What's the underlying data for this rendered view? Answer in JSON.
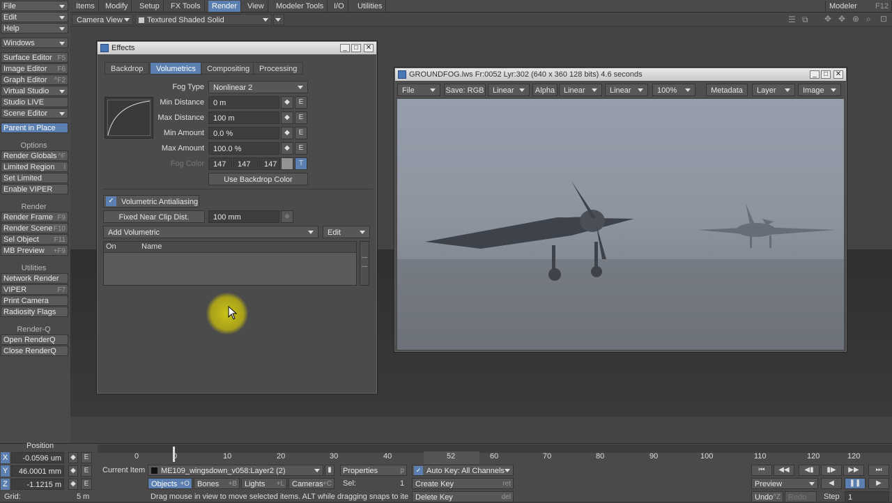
{
  "top_menu": {
    "items": [
      "Items",
      "Modify",
      "Setup",
      "FX Tools",
      "Render",
      "View",
      "Modeler Tools",
      "I/O",
      "Utilities"
    ],
    "active": "Render",
    "modeler": {
      "label": "Modeler",
      "shortcut": "F12"
    }
  },
  "left_panel": {
    "file": "File",
    "edit": "Edit",
    "help": "Help",
    "windows": "Windows",
    "editors": [
      {
        "label": "Surface Editor",
        "shortcut": "F5"
      },
      {
        "label": "Image Editor",
        "shortcut": "F6"
      },
      {
        "label": "Graph Editor",
        "shortcut": "^F2"
      },
      {
        "label": "Virtual Studio",
        "shortcut": ""
      },
      {
        "label": "Studio LIVE",
        "shortcut": ""
      },
      {
        "label": "Scene Editor",
        "shortcut": ""
      }
    ],
    "parent_in_place": "Parent in Place",
    "options_header": "Options",
    "options": [
      {
        "label": "Render Globals",
        "shortcut": "^F"
      },
      {
        "label": "Limited Region",
        "shortcut": "l"
      },
      {
        "label": "Set Limited Region",
        "shortcut": ""
      },
      {
        "label": "Enable VIPER",
        "shortcut": ""
      }
    ],
    "render_header": "Render",
    "render": [
      {
        "label": "Render Frame",
        "shortcut": "F9"
      },
      {
        "label": "Render Scene",
        "shortcut": "F10"
      },
      {
        "label": "Sel Object",
        "shortcut": "F11"
      },
      {
        "label": "MB Preview",
        "shortcut": "+F9"
      }
    ],
    "utilities_header": "Utilities",
    "utilities": [
      {
        "label": "Network Render",
        "shortcut": ""
      },
      {
        "label": "VIPER",
        "shortcut": "F7"
      },
      {
        "label": "Print Camera",
        "shortcut": ""
      },
      {
        "label": "Radiosity Flags",
        "shortcut": ""
      }
    ],
    "renderq_header": "Render-Q",
    "renderq": [
      {
        "label": "Open RenderQ",
        "shortcut": ""
      },
      {
        "label": "Close RenderQ",
        "shortcut": ""
      }
    ]
  },
  "viewport": {
    "camera": "Camera View",
    "shading": "Textured Shaded Solid"
  },
  "effects": {
    "title": "Effects",
    "tabs": [
      "Backdrop",
      "Volumetrics",
      "Compositing",
      "Processing"
    ],
    "active_tab": "Volumetrics",
    "fog_type_label": "Fog Type",
    "fog_type": "Nonlinear 2",
    "min_distance_label": "Min Distance",
    "min_distance": "0 m",
    "max_distance_label": "Max Distance",
    "max_distance": "100 m",
    "min_amount_label": "Min Amount",
    "min_amount": "0.0 %",
    "max_amount_label": "Max Amount",
    "max_amount": "100.0 %",
    "fog_color_label": "Fog Color",
    "fog_r": "147",
    "fog_g": "147",
    "fog_b": "147",
    "fog_color_swatch": "#939393",
    "env_e": "E",
    "texture_t": "T",
    "use_backdrop": "Use Backdrop Color",
    "vol_aa": "Volumetric Antialiasing",
    "fixed_near": "Fixed Near Clip Dist.",
    "fixed_near_value": "100 mm",
    "add_volumetric": "Add Volumetric",
    "edit": "Edit",
    "col_on": "On",
    "col_name": "Name"
  },
  "render_window": {
    "title": "GROUNDFOG.lws Fr:0052 Lyr:302  (640 x 360 128 bits) 4.6 seconds",
    "file": "File",
    "save": "Save: RGB",
    "linear1": "Linear",
    "alpha": "Alpha",
    "linear2": "Linear",
    "linear3": "Linear",
    "zoom": "100%",
    "metadata": "Metadata",
    "layer": "Layer",
    "image": "Image"
  },
  "bottom": {
    "position_label": "Position",
    "x_label": "X",
    "x": "-0.0596 um",
    "y_label": "Y",
    "y": "46.0001 mm",
    "z_label": "Z",
    "z": "-1.1215 m",
    "grid_label": "Grid:",
    "grid": "5 m",
    "ticks": [
      "0",
      "10",
      "20",
      "30",
      "40",
      "52",
      "60",
      "70",
      "80",
      "90",
      "100",
      "110",
      "120",
      "120"
    ],
    "current_frame": "52",
    "current_item_label": "Current Item",
    "current_item": "ME109_wingsdown_v058:Layer2 (2)",
    "properties": "Properties",
    "properties_sc": "p",
    "objects": "Objects",
    "objects_sc": "+O",
    "bones": "Bones",
    "bones_sc": "+B",
    "lights": "Lights",
    "lights_sc": "+L",
    "cameras": "Cameras",
    "cameras_sc": "+C",
    "sel_label": "Sel:",
    "sel": "1",
    "auto_key": "Auto Key: All Channels",
    "create_key": "Create Key",
    "create_key_sc": "ret",
    "delete_key": "Delete Key",
    "delete_key_sc": "del",
    "status": "Drag mouse in view to move selected items. ALT while dragging snaps to ite",
    "preview": "Preview",
    "undo": "Undo",
    "undo_sc": "^Z",
    "redo": "Redo",
    "step_label": "Step",
    "step": "1"
  },
  "colors": {
    "accent": "#5a7fb0",
    "axis_x": "#5a7fb0"
  }
}
